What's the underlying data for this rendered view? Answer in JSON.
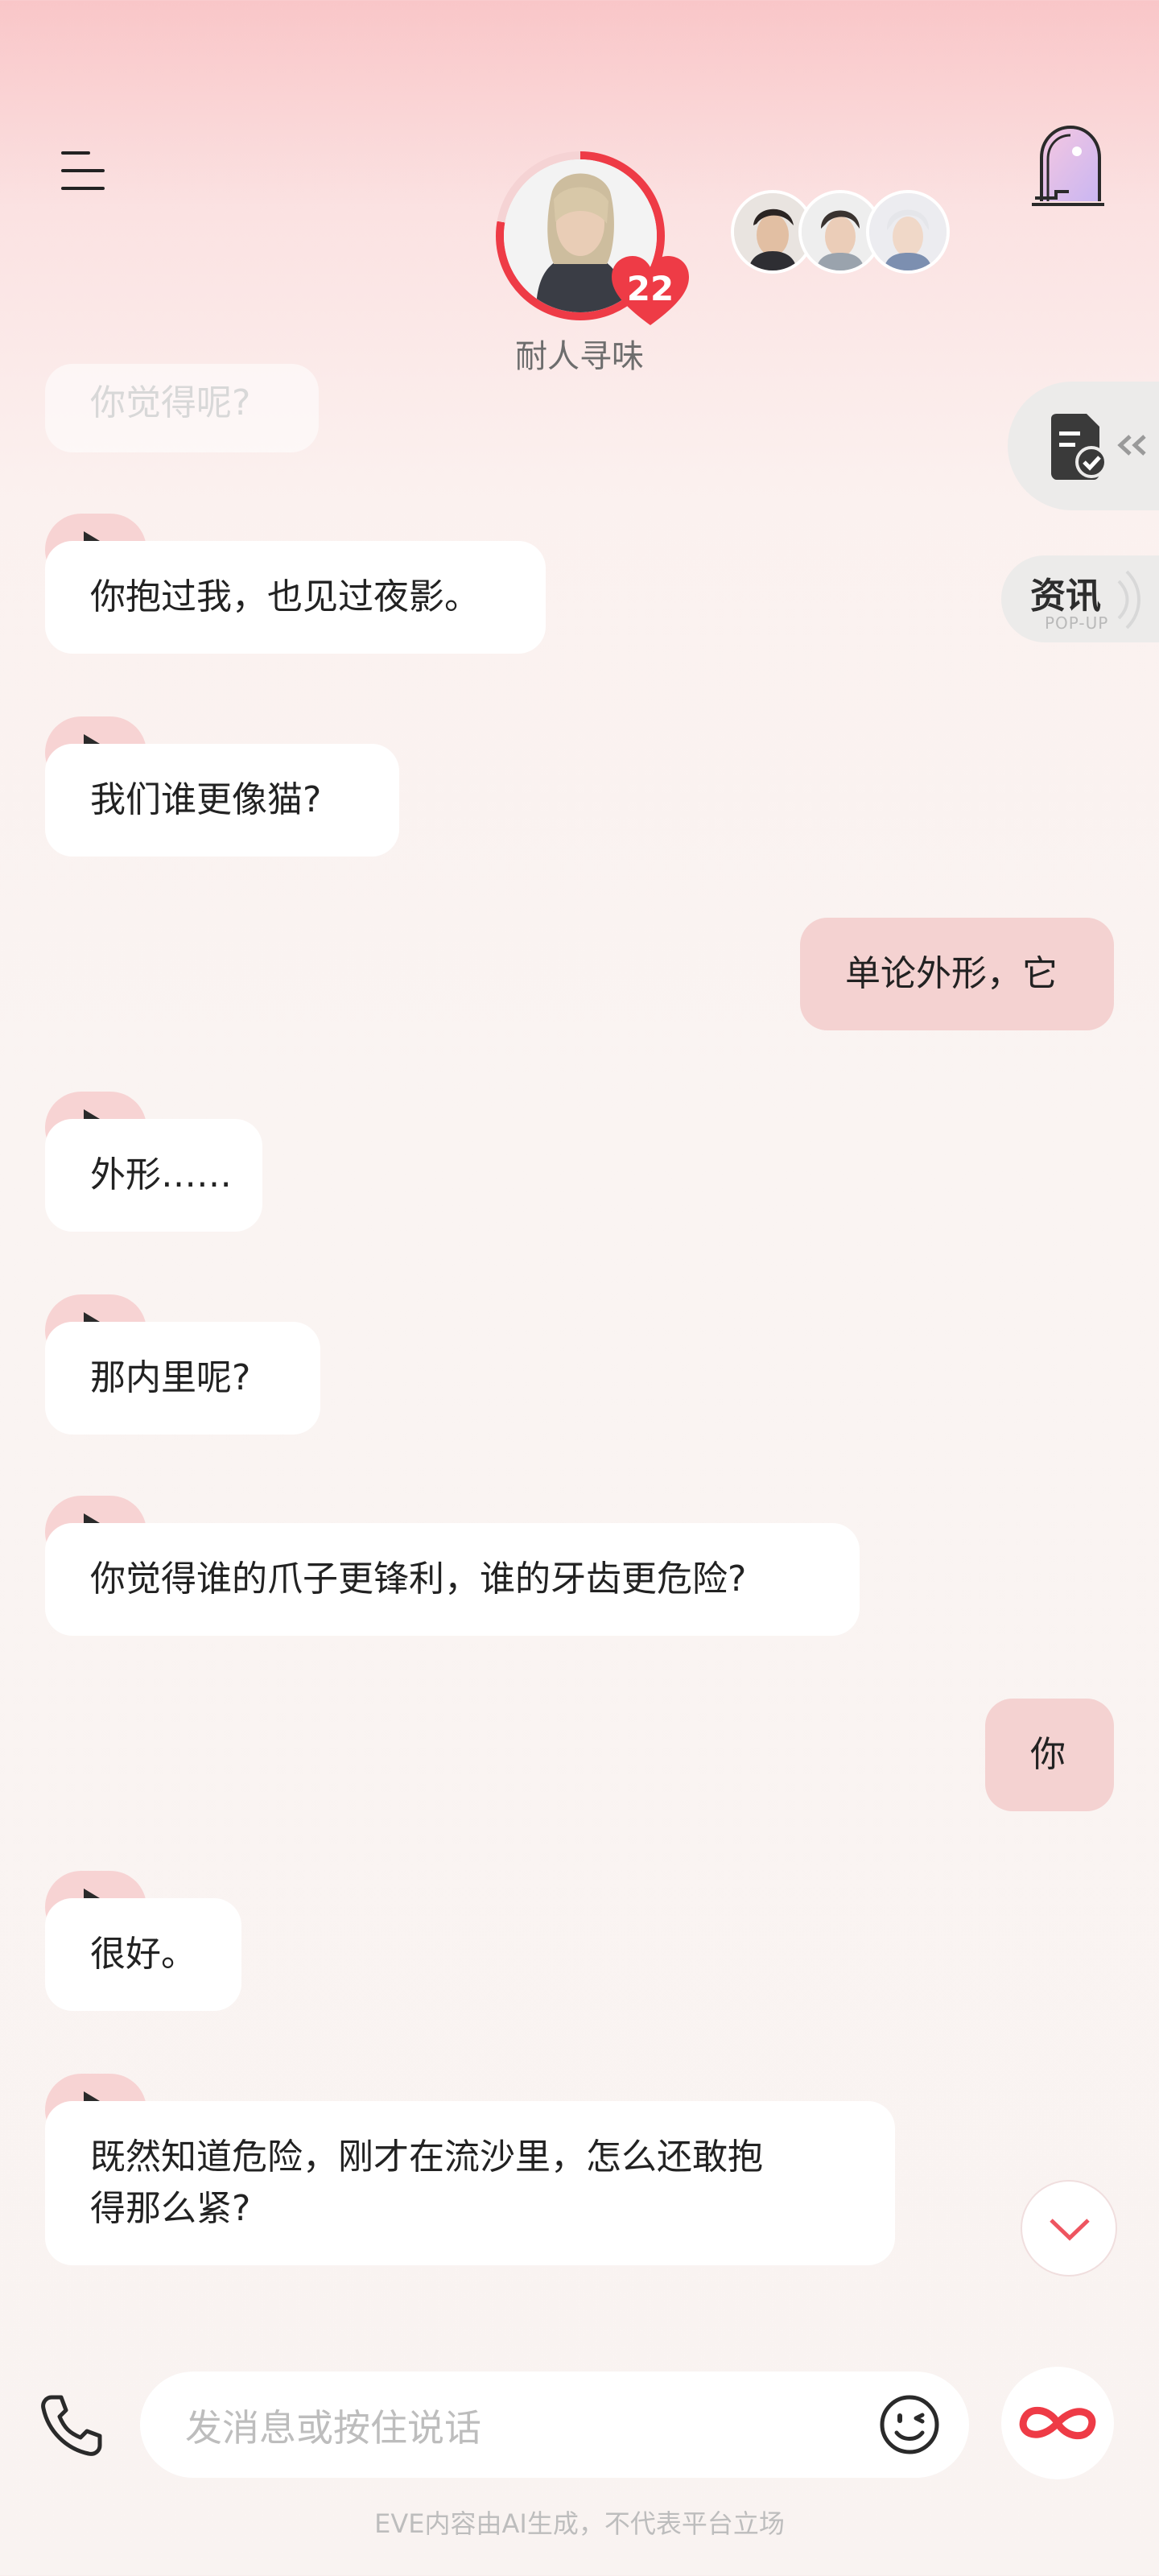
{
  "header": {
    "character_name": "耐人寻味",
    "affinity_level": "22",
    "menu_icon": "hamburger-menu-icon",
    "door_icon": "arched-door-icon"
  },
  "side_tabs": {
    "task_icon": "document-check-icon",
    "news_label": "资讯",
    "news_sub": "POP-UP"
  },
  "messages": [
    {
      "role": "ai",
      "text": "你觉得呢?",
      "faded": true
    },
    {
      "role": "ai",
      "text": "你抱过我，也见过夜影。"
    },
    {
      "role": "ai",
      "text": "我们谁更像猫?"
    },
    {
      "role": "user",
      "text": "单论外形，它"
    },
    {
      "role": "ai",
      "text": "外形……"
    },
    {
      "role": "ai",
      "text": "那内里呢?"
    },
    {
      "role": "ai",
      "text": "你觉得谁的爪子更锋利，谁的牙齿更危险?"
    },
    {
      "role": "user",
      "text": "你"
    },
    {
      "role": "ai",
      "text": "很好。"
    },
    {
      "role": "ai",
      "text_line1": "既然知道危险，刚才在流沙里，怎么还敢抱",
      "text_line2": "得那么紧?"
    }
  ],
  "input": {
    "placeholder": "发消息或按住说话"
  },
  "footer": {
    "disclaimer": "EVE内容由AI生成，不代表平台立场"
  },
  "colors": {
    "accent": "#ee3b46",
    "play_bg": "#f7d3d3",
    "user_bubble": "#f4d2d1",
    "ai_bubble": "#ffffff"
  }
}
